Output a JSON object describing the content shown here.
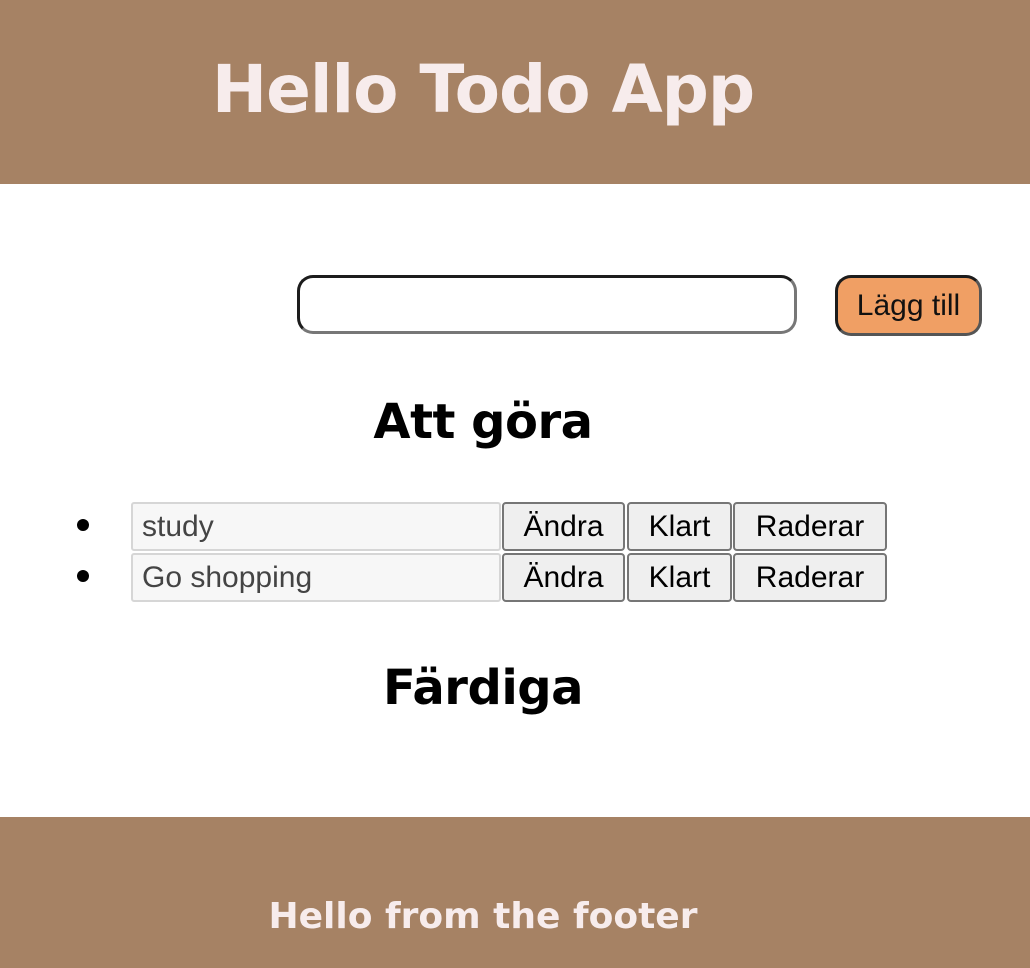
{
  "header": {
    "title": "Hello Todo App"
  },
  "new_todo": {
    "value": "",
    "placeholder": "",
    "add_label": "Lägg till"
  },
  "sections": {
    "todo_heading": "Att göra",
    "done_heading": "Färdiga"
  },
  "todos": [
    {
      "text": "study",
      "edit_label": "Ändra",
      "done_label": "Klart",
      "delete_label": "Raderar"
    },
    {
      "text": "Go shopping",
      "edit_label": "Ändra",
      "done_label": "Klart",
      "delete_label": "Raderar"
    }
  ],
  "done_todos": [],
  "footer": {
    "text": "Hello from the footer"
  },
  "colors": {
    "header_bg": "#a68264",
    "footer_bg": "#a68264",
    "header_text": "#f7ecec",
    "add_button_bg": "#f09f64"
  }
}
